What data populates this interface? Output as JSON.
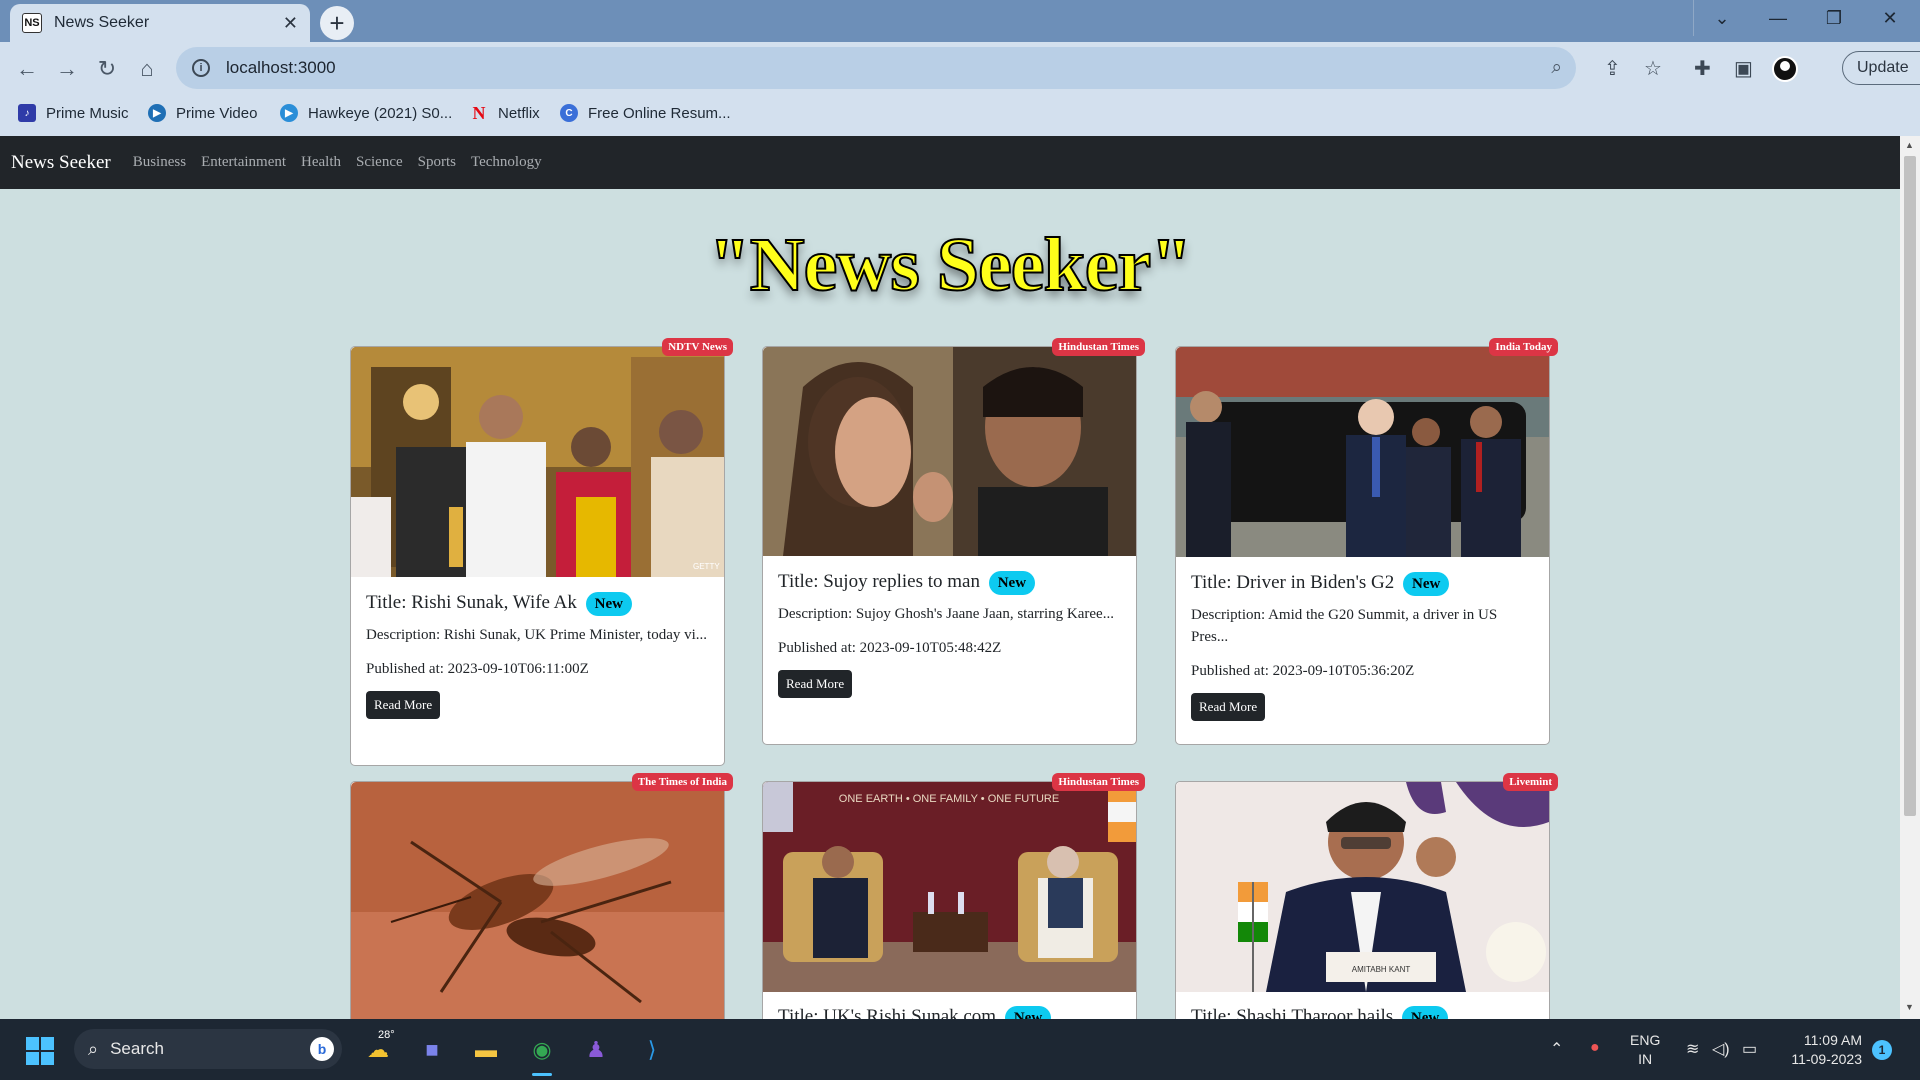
{
  "browser": {
    "tab_title": "News Seeker",
    "tab_favicon": "NS",
    "url": "localhost:3000",
    "update_label": "Update",
    "bookmarks": [
      {
        "label": "Prime Music",
        "icon": "prime-music-icon",
        "color": "#2f3ba8"
      },
      {
        "label": "Prime Video",
        "icon": "prime-video-icon",
        "color": "#1f6fb5"
      },
      {
        "label": "Hawkeye (2021) S0...",
        "icon": "play-icon",
        "color": "#2a8ed8"
      },
      {
        "label": "Netflix",
        "icon": "netflix-icon",
        "color": "#e50914"
      },
      {
        "label": "Free Online Resum...",
        "icon": "resume-icon",
        "color": "#3a6fd8"
      }
    ]
  },
  "site": {
    "brand": "News Seeker",
    "nav_links": [
      "Business",
      "Entertainment",
      "Health",
      "Science",
      "Sports",
      "Technology"
    ],
    "hero_title": "\"News Seeker\""
  },
  "cards": [
    {
      "source": "NDTV News",
      "title": "Title: Rishi Sunak, Wife Ak",
      "new_badge": "New",
      "description": "Description: Rishi Sunak, UK Prime Minister, today vi...",
      "published": "Published at: 2023-09-10T06:11:00Z",
      "button": "Read More",
      "image_credit": "GETTY"
    },
    {
      "source": "Hindustan Times",
      "title": "Title: Sujoy replies to man",
      "new_badge": "New",
      "description": "Description: Sujoy Ghosh's Jaane Jaan, starring Karee...",
      "published": "Published at: 2023-09-10T05:48:42Z",
      "button": "Read More"
    },
    {
      "source": "India Today",
      "title": "Title: Driver in Biden's G2",
      "new_badge": "New",
      "description": "Description: Amid the G20 Summit, a driver in US Pres...",
      "published": "Published at: 2023-09-10T05:36:20Z",
      "button": "Read More"
    },
    {
      "source": "The Times of India",
      "title": "",
      "new_badge": ""
    },
    {
      "source": "Hindustan Times",
      "title": "Title: UK's Rishi Sunak com",
      "new_badge": "New",
      "image_text": "ONE EARTH • ONE FAMILY • ONE FUTURE"
    },
    {
      "source": "Livemint",
      "title": "Title: Shashi Tharoor hails",
      "new_badge": "New",
      "image_text": "AMITABH KANT"
    }
  ],
  "taskbar": {
    "search_label": "Search",
    "weather": "28°",
    "lang_line1": "ENG",
    "lang_line2": "IN",
    "time": "11:09 AM",
    "date": "11-09-2023",
    "notifications": "1"
  }
}
